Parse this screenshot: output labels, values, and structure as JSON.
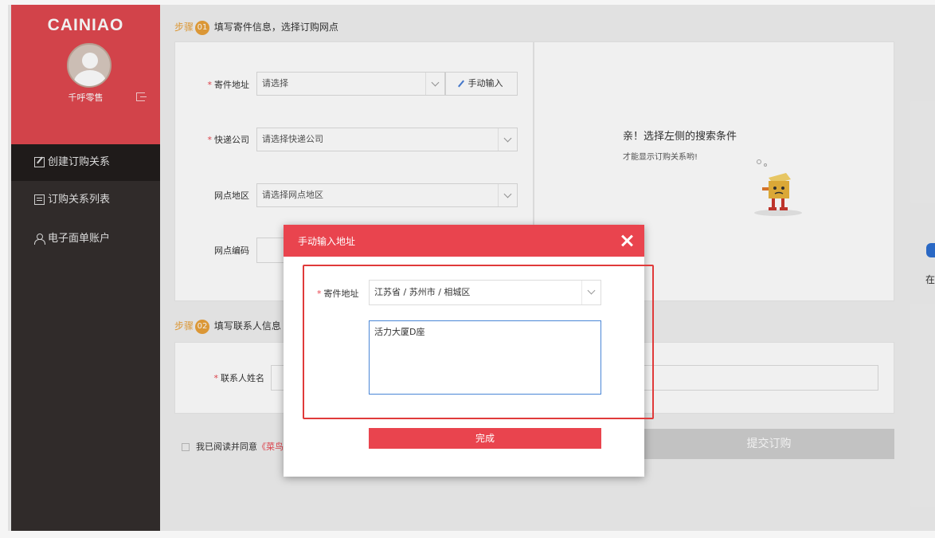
{
  "sidebar": {
    "brand": "CAINIAO",
    "username": "千呼零售",
    "items": [
      {
        "label": "创建订购关系"
      },
      {
        "label": "订购关系列表"
      },
      {
        "label": "电子面单账户"
      }
    ]
  },
  "step1": {
    "word": "步骤",
    "num": "01",
    "title": "填写寄件信息，选择订购网点",
    "sender_address_label": "寄件地址",
    "sender_address_placeholder": "请选择",
    "manual_input_label": "手动输入",
    "courier_label": "快递公司",
    "courier_placeholder": "请选择快递公司",
    "area_label": "网点地区",
    "area_placeholder": "请选择网点地区",
    "code_label": "网点编码"
  },
  "empty_state": {
    "title": "亲！选择左侧的搜索条件",
    "subtitle": "才能显示订购关系哟!"
  },
  "step2": {
    "word": "步骤",
    "num": "02",
    "title": "填写联系人信息",
    "contact_label": "联系人姓名"
  },
  "footer": {
    "agree_text": "我已阅读并同意",
    "agree_link": "《菜鸟",
    "submit_label": "提交订购"
  },
  "right_edge": {
    "text": "在"
  },
  "dialog": {
    "title": "手动输入地址",
    "address_label": "寄件地址",
    "address_value": "江苏省 / 苏州市 / 相城区",
    "detail_value": "活力大厦D座",
    "done_label": "完成"
  },
  "colors": {
    "brand_red": "#e9444e",
    "sidebar_dark": "#332e2d",
    "step_orange": "#e9a13a",
    "highlight": "#e03a3a"
  }
}
